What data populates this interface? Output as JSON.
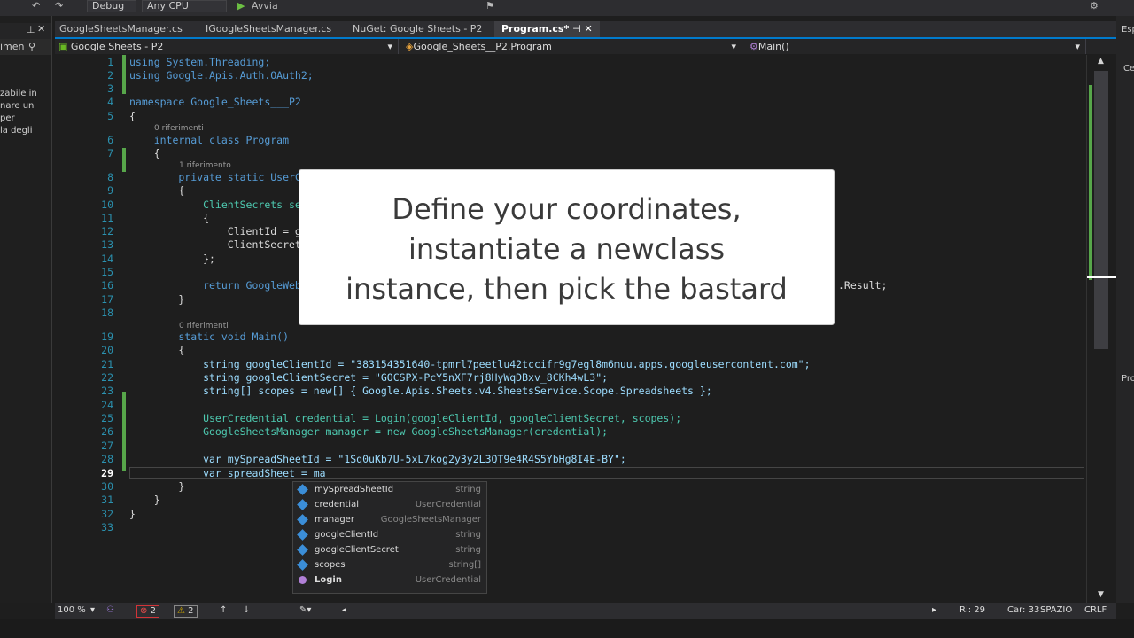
{
  "toolbar": {
    "config": "Debug",
    "platform": "Any CPU",
    "run_label": "Avvia"
  },
  "left_panel": {
    "header": "imen",
    "lines": [
      "zabile in",
      "nare un",
      " per",
      "la degli"
    ]
  },
  "tabs": [
    {
      "label": "GoogleSheetsManager.cs",
      "active": false
    },
    {
      "label": "IGoogleSheetsManager.cs",
      "active": false
    },
    {
      "label": "NuGet: Google Sheets - P2",
      "active": false
    },
    {
      "label": "Program.cs*",
      "active": true
    }
  ],
  "navbar": {
    "project": "Google Sheets - P2",
    "class": "Google_Sheets__P2.Program",
    "member": "Main()"
  },
  "code": {
    "l1": "using System.Threading;",
    "l2": "using Google.Apis.Auth.OAuth2;",
    "l4": "namespace Google_Sheets___P2",
    "l5": "{",
    "lens6": "0 riferimenti",
    "l6": "    internal class Program",
    "l7": "    {",
    "lens8": "1 riferimento",
    "l8": "        private static UserC",
    "l9": "        {",
    "l10": "            ClientSecrets se",
    "l11": "            {",
    "l12": "                ClientId = g",
    "l13": "                ClientSecret",
    "l14": "            };",
    "l16": "            return GoogleWeb",
    "l16_tail": ".Result;",
    "l17": "        }",
    "lens19": "0 riferimenti",
    "l19": "        static void Main()",
    "l20": "        {",
    "l21": "            string googleClientId = \"383154351640-tpmrl7peetlu42tccifr9g7egl8m6muu.apps.googleusercontent.com\";",
    "l22": "            string googleClientSecret = \"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\";",
    "l23": "            string[] scopes = new[] { Google.Apis.Sheets.v4.SheetsService.Scope.Spreadsheets };",
    "l25": "            UserCredential credential = Login(googleClientId, googleClientSecret, scopes);",
    "l26": "            GoogleSheetsManager manager = new GoogleSheetsManager(credential);",
    "l28": "            var mySpreadSheetId = \"1Sq0uKb7U-5xL7kog2y3y2L3QT9e4R4S5YbHg8I4E-BY\";",
    "l29": "            var spreadSheet = ma",
    "l30": "        }",
    "l31": "    }",
    "l32": "}"
  },
  "line_numbers": [
    "1",
    "2",
    "3",
    "4",
    "5",
    "6",
    "7",
    "8",
    "9",
    "10",
    "11",
    "12",
    "13",
    "14",
    "15",
    "16",
    "17",
    "18",
    "19",
    "20",
    "21",
    "22",
    "23",
    "24",
    "25",
    "26",
    "27",
    "28",
    "29",
    "30",
    "31",
    "32",
    "33"
  ],
  "popup": {
    "line1": "Define your coordinates,",
    "line2": "instantiate a newclass",
    "line3": "instance, then pick the bastard"
  },
  "intellisense": [
    {
      "name": "mySpreadSheetId",
      "type": "string",
      "icon": "field-icon"
    },
    {
      "name": "credential",
      "type": "UserCredential",
      "icon": "field-icon"
    },
    {
      "name": "manager",
      "type": "GoogleSheetsManager",
      "icon": "field-icon"
    },
    {
      "name": "googleClientId",
      "type": "string",
      "icon": "field-icon"
    },
    {
      "name": "googleClientSecret",
      "type": "string",
      "icon": "field-icon"
    },
    {
      "name": "scopes",
      "type": "string[]",
      "icon": "field-icon"
    },
    {
      "name": "Login",
      "type": "UserCredential",
      "icon": "method-icon"
    }
  ],
  "statusbar": {
    "zoom": "100 %",
    "errors": "2",
    "warnings": "2",
    "row": "Ri: 29",
    "col": "Car: 33",
    "spacing": "SPAZIO",
    "eol": "CRLF"
  },
  "right_panel": {
    "top": "Esp",
    "middle": "Ce",
    "lower": "Pro"
  }
}
